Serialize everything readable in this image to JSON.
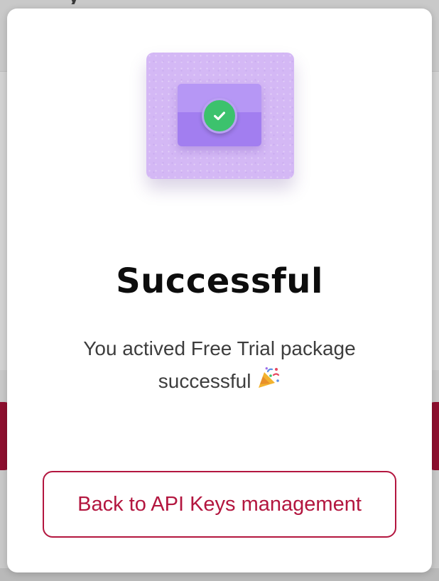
{
  "backdrop": {
    "heading_fragment": "y"
  },
  "modal": {
    "illustration_icon": "envelope-check-icon",
    "title": "Successful",
    "message": "You actived Free Trial package successful",
    "message_emoji_icon": "party-popper-icon",
    "back_button_label": "Back to API Keys management"
  },
  "colors": {
    "accent": "#b3163f",
    "success": "#3cc26d",
    "illustration_bg": "#d4b8f5",
    "envelope": "#a27ef0"
  }
}
